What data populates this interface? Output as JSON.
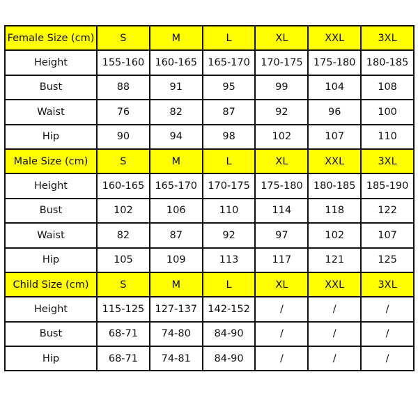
{
  "header_color": "#ffff00",
  "sections": [
    {
      "title": "Female Size (cm)",
      "sizes": [
        "S",
        "M",
        "L",
        "XL",
        "XXL",
        "3XL"
      ],
      "rows": [
        {
          "label": "Height",
          "values": [
            "155-160",
            "160-165",
            "165-170",
            "170-175",
            "175-180",
            "180-185"
          ]
        },
        {
          "label": "Bust",
          "values": [
            "88",
            "91",
            "95",
            "99",
            "104",
            "108"
          ]
        },
        {
          "label": "Waist",
          "values": [
            "76",
            "82",
            "87",
            "92",
            "96",
            "100"
          ]
        },
        {
          "label": "Hip",
          "values": [
            "90",
            "94",
            "98",
            "102",
            "107",
            "110"
          ]
        }
      ]
    },
    {
      "title": "Male Size (cm)",
      "sizes": [
        "S",
        "M",
        "L",
        "XL",
        "XXL",
        "3XL"
      ],
      "rows": [
        {
          "label": "Height",
          "values": [
            "160-165",
            "165-170",
            "170-175",
            "175-180",
            "180-185",
            "185-190"
          ]
        },
        {
          "label": "Bust",
          "values": [
            "102",
            "106",
            "110",
            "114",
            "118",
            "122"
          ]
        },
        {
          "label": "Waist",
          "values": [
            "82",
            "87",
            "92",
            "97",
            "102",
            "107"
          ]
        },
        {
          "label": "Hip",
          "values": [
            "105",
            "109",
            "113",
            "117",
            "121",
            "125"
          ]
        }
      ]
    },
    {
      "title": "Child Size (cm)",
      "sizes": [
        "S",
        "M",
        "L",
        "XL",
        "XXL",
        "3XL"
      ],
      "rows": [
        {
          "label": "Height",
          "values": [
            "115-125",
            "127-137",
            "142-152",
            "/",
            "/",
            "/"
          ]
        },
        {
          "label": "Bust",
          "values": [
            "68-71",
            "74-80",
            "84-90",
            "/",
            "/",
            "/"
          ]
        },
        {
          "label": "Hip",
          "values": [
            "68-71",
            "74-81",
            "84-90",
            "/",
            "/",
            "/"
          ]
        }
      ]
    }
  ]
}
